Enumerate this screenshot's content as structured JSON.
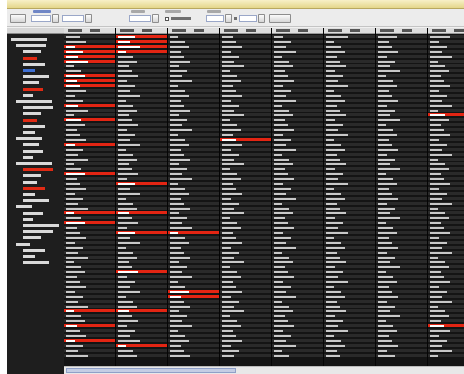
{
  "window": {
    "title": ""
  },
  "toolbar": {
    "run_button": {
      "label": ""
    },
    "fields": [
      {
        "label": "",
        "value": ""
      },
      {
        "label": "",
        "value": ""
      },
      {
        "label": "",
        "value": ""
      },
      {
        "label": "",
        "value": ""
      },
      {
        "label": "",
        "value": ""
      }
    ],
    "checkbox": {
      "label": "",
      "checked": false
    },
    "apply_button": {
      "label": ""
    }
  },
  "sidebar": {
    "header": "",
    "items": [
      {
        "level": 0,
        "state": "normal"
      },
      {
        "level": 1,
        "state": "normal"
      },
      {
        "level": 2,
        "state": "normal"
      },
      {
        "level": 2,
        "state": "highlight"
      },
      {
        "level": 2,
        "state": "normal"
      },
      {
        "level": 2,
        "state": "selected"
      },
      {
        "level": 2,
        "state": "normal"
      },
      {
        "level": 2,
        "state": "normal"
      },
      {
        "level": 2,
        "state": "highlight"
      },
      {
        "level": 2,
        "state": "normal"
      },
      {
        "level": 1,
        "state": "normal"
      },
      {
        "level": 2,
        "state": "normal"
      },
      {
        "level": 2,
        "state": "normal"
      },
      {
        "level": 2,
        "state": "highlight"
      },
      {
        "level": 2,
        "state": "normal"
      },
      {
        "level": 2,
        "state": "normal"
      },
      {
        "level": 1,
        "state": "normal"
      },
      {
        "level": 2,
        "state": "normal"
      },
      {
        "level": 2,
        "state": "normal"
      },
      {
        "level": 2,
        "state": "normal"
      },
      {
        "level": 1,
        "state": "normal"
      },
      {
        "level": 2,
        "state": "highlight"
      },
      {
        "level": 2,
        "state": "normal"
      },
      {
        "level": 2,
        "state": "normal"
      },
      {
        "level": 2,
        "state": "highlight"
      },
      {
        "level": 2,
        "state": "normal"
      },
      {
        "level": 2,
        "state": "normal"
      },
      {
        "level": 1,
        "state": "normal"
      },
      {
        "level": 2,
        "state": "normal"
      },
      {
        "level": 2,
        "state": "normal"
      },
      {
        "level": 2,
        "state": "normal"
      },
      {
        "level": 2,
        "state": "normal"
      },
      {
        "level": 2,
        "state": "normal"
      },
      {
        "level": 1,
        "state": "normal"
      },
      {
        "level": 2,
        "state": "normal"
      },
      {
        "level": 2,
        "state": "normal"
      },
      {
        "level": 2,
        "state": "normal"
      }
    ]
  },
  "grid": {
    "columns": [
      {
        "header": "",
        "highlighted_rows": [
          2,
          3,
          4,
          5,
          8,
          9,
          10,
          14,
          17,
          22,
          28,
          36,
          38,
          56,
          59,
          62
        ]
      },
      {
        "header": "",
        "highlighted_rows": [
          0,
          1,
          2,
          3,
          30,
          36,
          40,
          48,
          56,
          63
        ]
      },
      {
        "header": "",
        "highlighted_rows": [
          40,
          52,
          53
        ]
      },
      {
        "header": "",
        "highlighted_rows": [
          21
        ]
      },
      {
        "header": "",
        "highlighted_rows": []
      },
      {
        "header": "",
        "highlighted_rows": []
      },
      {
        "header": "",
        "highlighted_rows": []
      },
      {
        "header": "",
        "highlighted_rows": [
          16,
          59
        ]
      }
    ],
    "row_count": 66
  },
  "colors": {
    "highlight": "#e32513",
    "selected": "#3e6fd3",
    "grid_background": "#0d0d0d",
    "titlebar": "#efe3a4"
  }
}
